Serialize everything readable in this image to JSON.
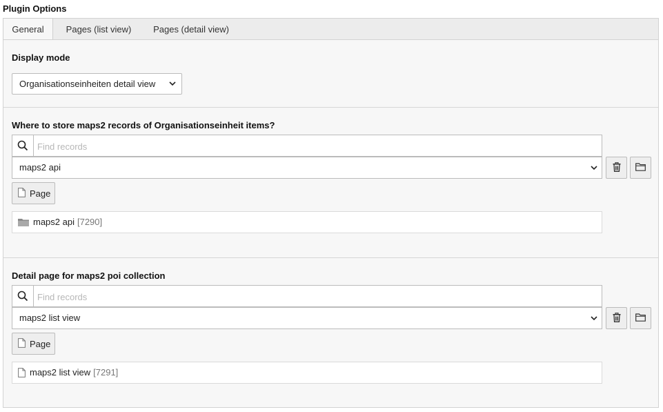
{
  "heading": "Plugin Options",
  "tabs": [
    {
      "label": "General"
    },
    {
      "label": "Pages (list view)"
    },
    {
      "label": "Pages (detail view)"
    }
  ],
  "display_mode": {
    "label": "Display mode",
    "selected": "Organisationseinheiten detail view"
  },
  "storage": {
    "label": "Where to store maps2 records of Organisationseinheit items?",
    "search_placeholder": "Find records",
    "selected": "maps2 api",
    "page_button": "Page",
    "record_title": "maps2 api",
    "record_uid": "[7290]"
  },
  "detail_page": {
    "label": "Detail page for maps2 poi collection",
    "search_placeholder": "Find records",
    "selected": "maps2 list view",
    "page_button": "Page",
    "record_title": "maps2 list view",
    "record_uid": "[7291]"
  }
}
